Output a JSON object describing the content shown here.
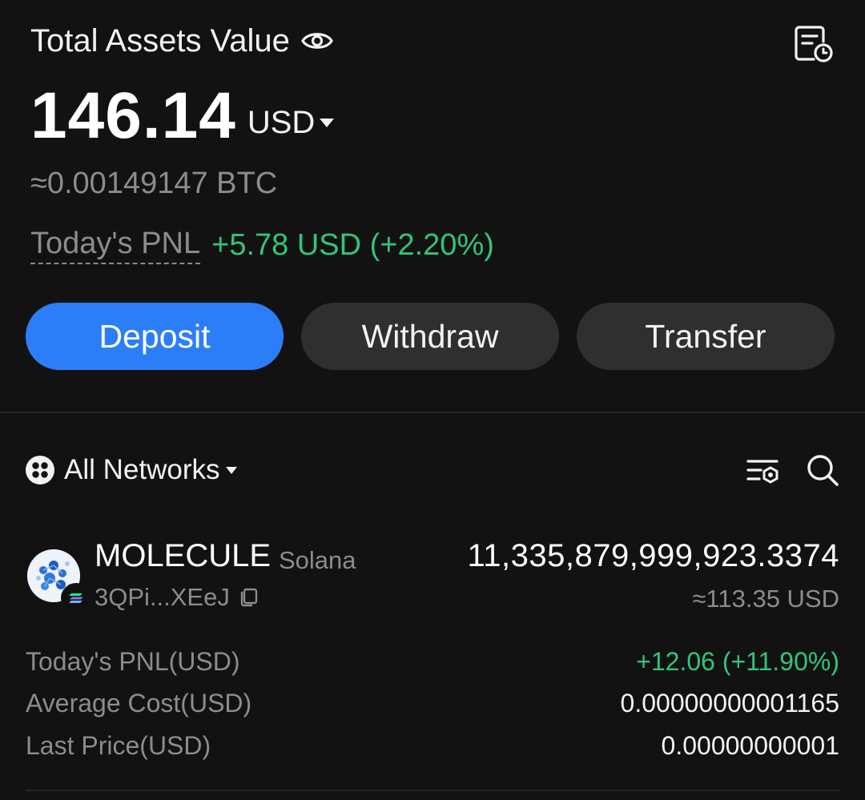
{
  "header": {
    "title": "Total Assets Value",
    "amount": "146.14",
    "currency": "USD",
    "btc_equivalent": "≈0.00149147 BTC",
    "pnl_label": "Today's PNL",
    "pnl_value": "+5.78 USD (+2.20%)"
  },
  "actions": {
    "deposit": "Deposit",
    "withdraw": "Withdraw",
    "transfer": "Transfer"
  },
  "network_filter": {
    "label": "All Networks"
  },
  "token": {
    "name": "MOLECULE",
    "chain": "Solana",
    "address": "3QPi...XEeJ",
    "balance": "11,335,879,999,923.3374",
    "usd_value": "≈113.35 USD",
    "stats": [
      {
        "label": "Today's PNL(USD)",
        "value": "+12.06 (+11.90%)"
      },
      {
        "label": "Average Cost(USD)",
        "value": "0.00000000001165"
      },
      {
        "label": "Last Price(USD)",
        "value": "0.00000000001"
      }
    ]
  },
  "colors": {
    "background": "#121212",
    "accent_blue": "#2b7ef7",
    "positive_green": "#33c47a",
    "muted_text": "#8c8c8c",
    "button_dark": "#2f2f2f"
  },
  "icons": [
    "eye-icon",
    "history-icon",
    "caret-down-icon",
    "network-icon",
    "filter-icon",
    "search-icon",
    "copy-icon",
    "solana-badge-icon"
  ]
}
